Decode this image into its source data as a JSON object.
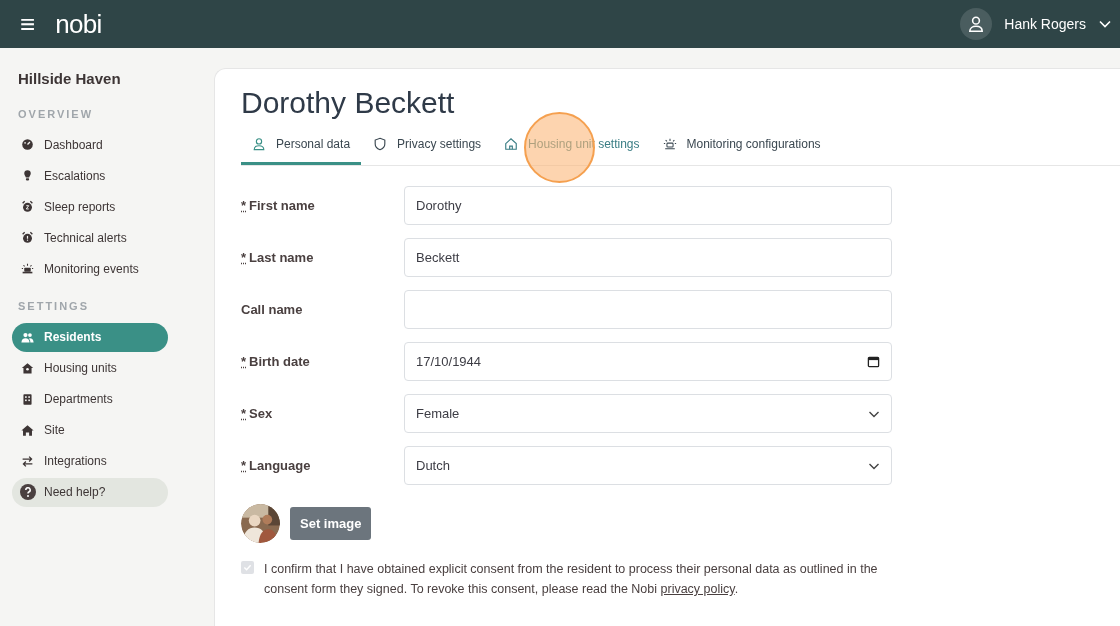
{
  "header": {
    "logo": "nobi",
    "menu_glyph": "≡",
    "user": "Hank Rogers"
  },
  "sidebar": {
    "site": "Hillside Haven",
    "sections": [
      {
        "title": "OVERVIEW",
        "items": [
          {
            "label": "Dashboard",
            "selected": false
          },
          {
            "label": "Escalations",
            "selected": false
          },
          {
            "label": "Sleep reports",
            "selected": false
          },
          {
            "label": "Technical alerts",
            "selected": false
          },
          {
            "label": "Monitoring events",
            "selected": false
          }
        ]
      },
      {
        "title": "SETTINGS",
        "items": [
          {
            "label": "Residents",
            "selected": true
          },
          {
            "label": "Housing units",
            "selected": false
          },
          {
            "label": "Departments",
            "selected": false
          },
          {
            "label": "Site",
            "selected": false
          },
          {
            "label": "Integrations",
            "selected": false
          }
        ]
      }
    ],
    "help": "Need help?"
  },
  "page": {
    "title": "Dorothy Beckett",
    "tabs": [
      {
        "label": "Personal data",
        "selected": true,
        "hovered": false
      },
      {
        "label": "Privacy settings",
        "selected": false,
        "hovered": false
      },
      {
        "label": "Housing unit settings",
        "selected": false,
        "hovered": true
      },
      {
        "label": "Monitoring configurations",
        "selected": false,
        "hovered": false
      }
    ],
    "required_mark": "*",
    "fields": [
      {
        "kind": "text",
        "label": "First name",
        "required": true,
        "value": "Dorothy"
      },
      {
        "kind": "text",
        "label": "Last name",
        "required": true,
        "value": "Beckett"
      },
      {
        "kind": "text",
        "label": "Call name",
        "required": false
      },
      {
        "kind": "date",
        "label": "Birth date",
        "required": true,
        "value": "17/10/1944"
      },
      {
        "kind": "select",
        "label": "Sex",
        "required": true,
        "value": "Female"
      },
      {
        "kind": "select",
        "label": "Language",
        "required": true,
        "value": "Dutch"
      }
    ],
    "image_button": "Set image",
    "consent": {
      "checked": true,
      "text": "I confirm that I have obtained explicit consent from the resident to process their personal data as outlined in the consent form they signed. To revoke this consent, please read the Nobi ",
      "link": "privacy policy",
      "after": "."
    }
  }
}
